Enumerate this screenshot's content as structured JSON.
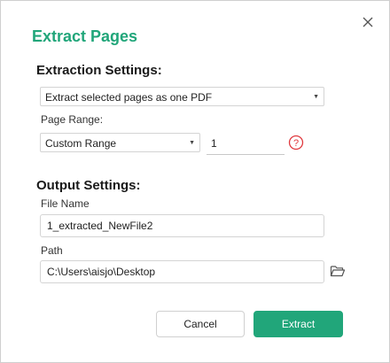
{
  "dialog": {
    "title": "Extract Pages",
    "close_icon": "close-icon"
  },
  "extraction": {
    "heading": "Extraction Settings:",
    "mode_selected": "Extract selected pages as one PDF",
    "page_range_label": "Page Range:",
    "range_type_selected": "Custom Range",
    "range_value": "1",
    "help_icon": "question-circle-icon"
  },
  "output": {
    "heading": "Output Settings:",
    "file_name_label": "File Name",
    "file_name_value": "1_extracted_NewFile2",
    "path_label": "Path",
    "path_value": "C:\\Users\\aisjo\\Desktop",
    "folder_icon": "folder-icon"
  },
  "buttons": {
    "cancel": "Cancel",
    "extract": "Extract"
  },
  "colors": {
    "accent": "#21a67a",
    "help_icon": "#e0393e"
  }
}
